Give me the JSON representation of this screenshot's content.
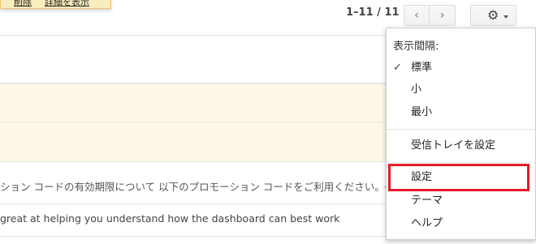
{
  "notice": {
    "link_1": "削除",
    "link_2": "詳細を表示"
  },
  "pager": {
    "count": "1–11 / 11",
    "prev_glyph": "‹",
    "next_glyph": "›"
  },
  "settings_button": {
    "icon": "gear-icon",
    "glyph": "⚙"
  },
  "rows": [
    {
      "text": ""
    },
    {
      "text": ""
    },
    {
      "text": ""
    },
    {
      "text": "ション コードの有効期限について 以下のプロモーション コードをご利用ください。C"
    },
    {
      "text": "great at helping you understand how the dashboard can best work"
    }
  ],
  "menu": {
    "heading": "表示間隔:",
    "check_glyph": "✓",
    "density": [
      "標準",
      "小",
      "最小"
    ],
    "configure_inbox": "受信トレイを設定",
    "settings": "設定",
    "theme": "テーマ",
    "help": "ヘルプ"
  },
  "colors": {
    "highlight": "#e41b2b",
    "unread_row": "#fff8e6"
  }
}
